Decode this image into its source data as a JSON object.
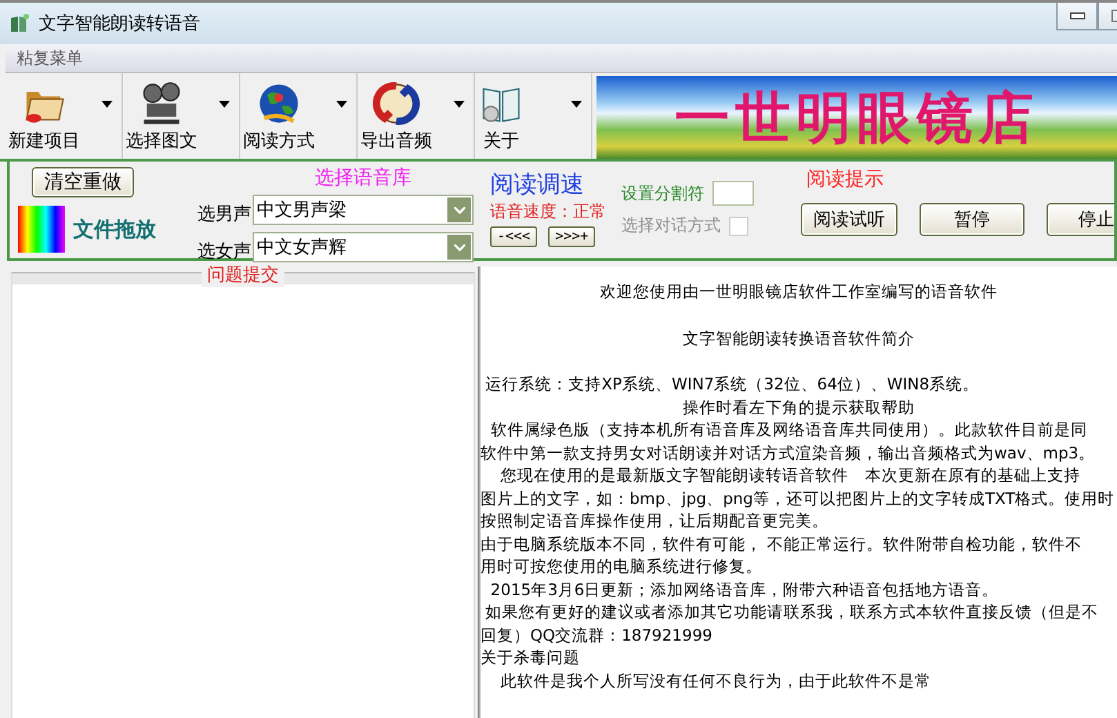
{
  "window": {
    "title": "文字智能朗读转语音"
  },
  "menu_bar": {
    "label": "粘复菜单"
  },
  "toolbar": [
    {
      "label": "新建项目",
      "kind": "folder"
    },
    {
      "label": "选择图文",
      "kind": "projector"
    },
    {
      "label": "阅读方式",
      "kind": "globe"
    },
    {
      "label": "导出音频",
      "kind": "arrows"
    },
    {
      "label": "关于",
      "kind": "book"
    }
  ],
  "banner": {
    "text": "一世明眼镜店"
  },
  "controls": {
    "clear_button": "清空重做",
    "drop_label": "文件拖放",
    "voice_heading": "选择语音库",
    "voices": [
      {
        "label": "选男声",
        "value": "中文男声梁"
      },
      {
        "label": "选女声",
        "value": "中文女声辉"
      }
    ],
    "speed_heading": "阅读调速",
    "speed_label": "语音速度：正常",
    "slower_button": "-<<<",
    "faster_button": ">>>+",
    "separator_label": "设置分割符",
    "dialog_mode": {
      "label": "选择对话方式",
      "checked": false,
      "disabled": true
    },
    "hint_heading": "阅读提示",
    "buttons": [
      "阅读试听",
      "暂停",
      "停止"
    ]
  },
  "feedback_panel": {
    "title": "问题提交"
  },
  "text_panel": {
    "lines": [
      {
        "text": "欢迎您使用由一世明眼镜店软件工作室编写的语音软件",
        "kind": "center"
      },
      {
        "text": "文字智能朗读转换语音软件简介",
        "kind": "center"
      },
      {
        "text": " 运行系统：支持XP系统、WIN7系统（32位、64位）、WIN8系统。",
        "kind": "left"
      },
      {
        "text": "操作时看左下角的提示获取帮助",
        "kind": "center"
      },
      {
        "text": "  软件属绿色版（支持本机所有语音库及网络语音库共同使用）。此款软件目前是同",
        "kind": "left"
      },
      {
        "text": "软件中第一款支持男女对话朗读并对话方式渲染音频，输出音频格式为wav、mp3。",
        "kind": "left"
      },
      {
        "text": "    您现在使用的是最新版文字智能朗读转语音软件　本次更新在原有的基础上支持",
        "kind": "left"
      },
      {
        "text": "图片上的文字，如：bmp、jpg、png等，还可以把图片上的文字转成TXT格式。使用时",
        "kind": "left"
      },
      {
        "text": "按照制定语音库操作使用，让后期配音更完美。",
        "kind": "left"
      },
      {
        "text": "由于电脑系统版本不同，软件有可能， 不能正常运行。软件附带自检功能，软件不",
        "kind": "left"
      },
      {
        "text": "用时可按您使用的电脑系统进行修复。",
        "kind": "left"
      },
      {
        "text": "  2015年3月6日更新；添加网络语音库，附带六种语音包括地方语音。",
        "kind": "left"
      },
      {
        "text": " 如果您有更好的建议或者添加其它功能请联系我，联系方式本软件直接反馈（但是不",
        "kind": "left"
      },
      {
        "text": "回复）QQ交流群：187921999",
        "kind": "left"
      },
      {
        "text": "关于杀毒问题",
        "kind": "left"
      },
      {
        "text": "    此软件是我个人所写没有任何不良行为，由于此软件不是常",
        "kind": "left"
      }
    ]
  }
}
